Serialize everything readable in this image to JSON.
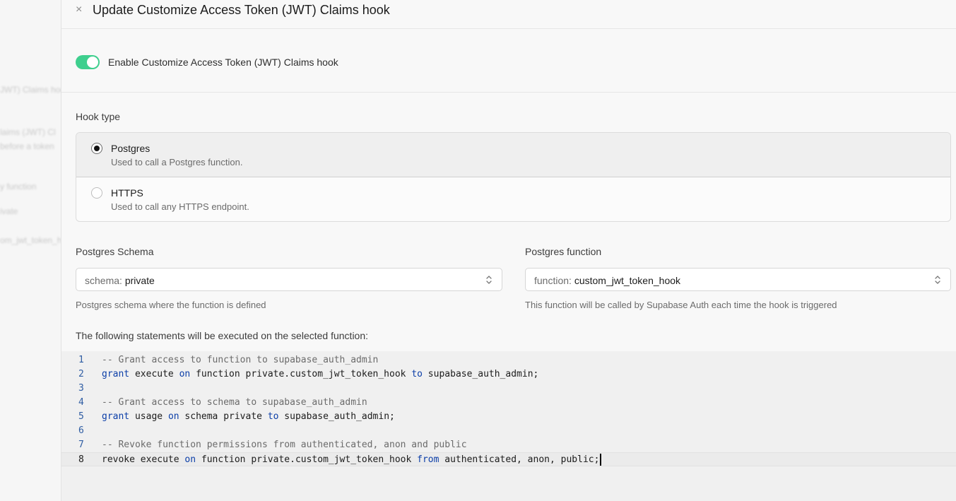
{
  "backdrop": {
    "fragments": [
      "JWT) Claims hook",
      "laims (JWT) Cl",
      "before a token",
      "y function",
      "ivate",
      "om_jwt_token_hook"
    ]
  },
  "modal": {
    "title": "Update Customize Access Token (JWT) Claims hook",
    "close_label": "×"
  },
  "enable": {
    "label": "Enable Customize Access Token (JWT) Claims hook",
    "on": true
  },
  "hook_type": {
    "label": "Hook type",
    "options": [
      {
        "title": "Postgres",
        "description": "Used to call a Postgres function.",
        "selected": true
      },
      {
        "title": "HTTPS",
        "description": "Used to call any HTTPS endpoint.",
        "selected": false
      }
    ]
  },
  "schema": {
    "label": "Postgres Schema",
    "prefix": "schema:",
    "value": "private",
    "helper": "Postgres schema where the function is defined"
  },
  "function": {
    "label": "Postgres function",
    "prefix": "function:",
    "value": "custom_jwt_token_hook",
    "helper": "This function will be called by Supabase Auth each time the hook is triggered"
  },
  "statements": {
    "label": "The following statements will be executed on the selected function:",
    "lines": [
      {
        "n": "1",
        "tokens": [
          {
            "t": "-- Grant access to function to supabase_auth_admin",
            "c": "cm"
          }
        ]
      },
      {
        "n": "2",
        "tokens": [
          {
            "t": "grant",
            "c": "kw"
          },
          {
            "t": " execute ",
            "c": ""
          },
          {
            "t": "on",
            "c": "kw"
          },
          {
            "t": " function private.custom_jwt_token_hook ",
            "c": ""
          },
          {
            "t": "to",
            "c": "kw"
          },
          {
            "t": " supabase_auth_admin;",
            "c": ""
          }
        ]
      },
      {
        "n": "3",
        "tokens": []
      },
      {
        "n": "4",
        "tokens": [
          {
            "t": "-- Grant access to schema to supabase_auth_admin",
            "c": "cm"
          }
        ]
      },
      {
        "n": "5",
        "tokens": [
          {
            "t": "grant",
            "c": "kw"
          },
          {
            "t": " usage ",
            "c": ""
          },
          {
            "t": "on",
            "c": "kw"
          },
          {
            "t": " schema private ",
            "c": ""
          },
          {
            "t": "to",
            "c": "kw"
          },
          {
            "t": " supabase_auth_admin;",
            "c": ""
          }
        ]
      },
      {
        "n": "6",
        "tokens": []
      },
      {
        "n": "7",
        "tokens": [
          {
            "t": "-- Revoke function permissions from authenticated, anon and public",
            "c": "cm"
          }
        ]
      },
      {
        "n": "8",
        "tokens": [
          {
            "t": "revoke execute ",
            "c": ""
          },
          {
            "t": "on",
            "c": "kw"
          },
          {
            "t": " function private.custom_jwt_token_hook ",
            "c": ""
          },
          {
            "t": "from",
            "c": "kw"
          },
          {
            "t": " authenticated, anon, public;",
            "c": ""
          }
        ],
        "active": true
      }
    ]
  },
  "colors": {
    "toggle_on": "#3ecf8e",
    "keyword": "#0b3ea8",
    "comment": "#6b6b6b"
  }
}
